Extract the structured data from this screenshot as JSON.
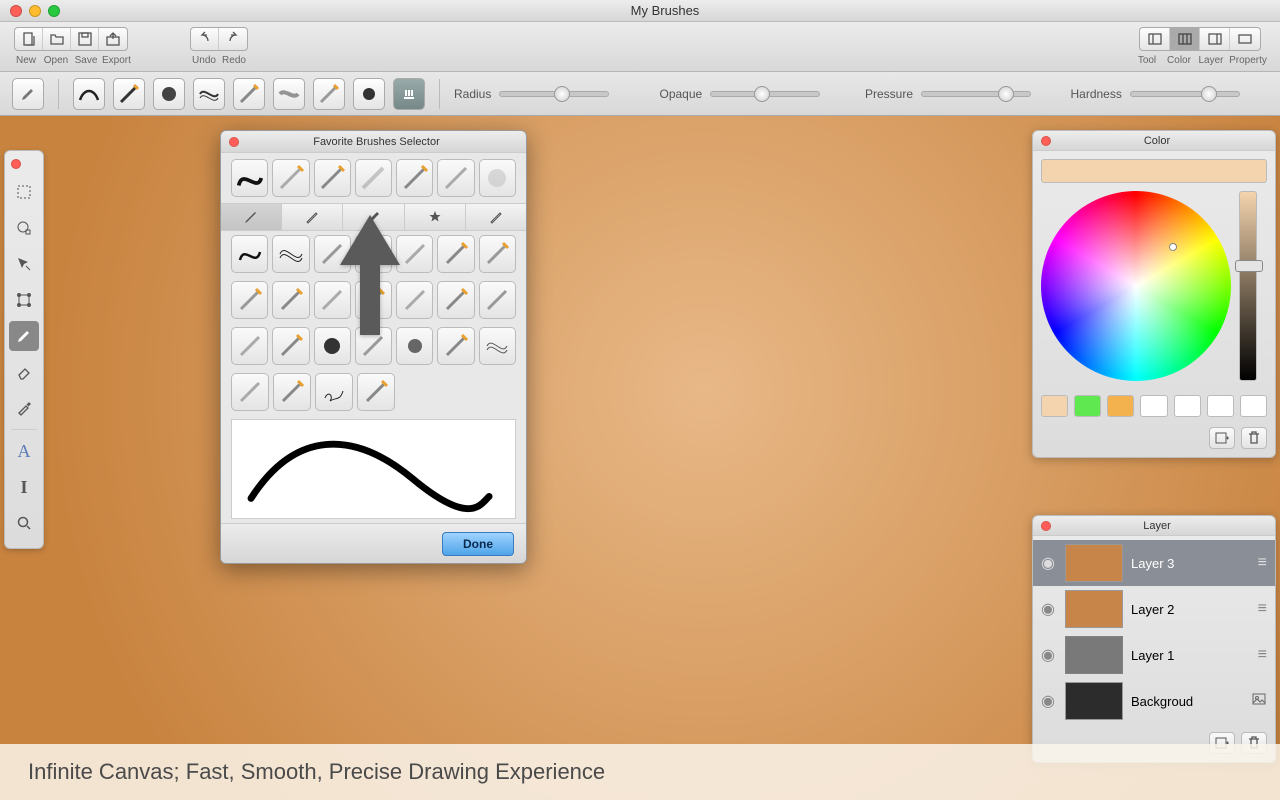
{
  "window": {
    "title": "My Brushes"
  },
  "toolbar1": {
    "file": {
      "new": "New",
      "open": "Open",
      "save": "Save",
      "export": "Export"
    },
    "edit": {
      "undo": "Undo",
      "redo": "Redo"
    },
    "view": {
      "tool": "Tool",
      "color": "Color",
      "layer": "Layer",
      "property": "Property"
    }
  },
  "toolbar2": {
    "sliders": {
      "radius": {
        "label": "Radius",
        "value": 50
      },
      "opaque": {
        "label": "Opaque",
        "value": 40
      },
      "pressure": {
        "label": "Pressure",
        "value": 70
      },
      "hardness": {
        "label": "Hardness",
        "value": 65
      }
    }
  },
  "popup": {
    "title": "Favorite Brushes Selector",
    "done": "Done"
  },
  "color_panel": {
    "title": "Color",
    "current": "#f4d4ae",
    "swatches": [
      "#f4d4ae",
      "#5fe84f",
      "#f4b24e",
      "#ffffff",
      "#ffffff",
      "#ffffff",
      "#ffffff"
    ]
  },
  "layer_panel": {
    "title": "Layer",
    "layers": [
      {
        "name": "Layer 3",
        "active": true
      },
      {
        "name": "Layer 2",
        "active": false
      },
      {
        "name": "Layer 1",
        "active": false
      },
      {
        "name": "Backgroud",
        "active": false
      }
    ]
  },
  "caption": "Infinite Canvas; Fast, Smooth, Precise Drawing Experience"
}
